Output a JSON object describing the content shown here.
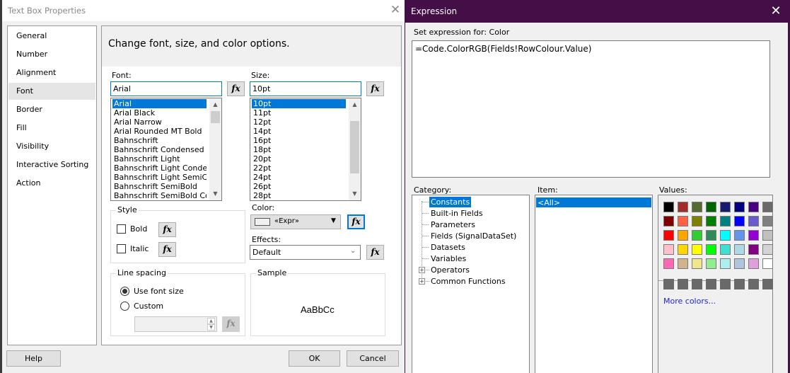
{
  "text_box_properties": {
    "title": "Text Box Properties",
    "nav_items": [
      {
        "label": "General",
        "active": false
      },
      {
        "label": "Number",
        "active": false
      },
      {
        "label": "Alignment",
        "active": false
      },
      {
        "label": "Font",
        "active": true
      },
      {
        "label": "Border",
        "active": false
      },
      {
        "label": "Fill",
        "active": false
      },
      {
        "label": "Visibility",
        "active": false
      },
      {
        "label": "Interactive Sorting",
        "active": false
      },
      {
        "label": "Action",
        "active": false
      }
    ],
    "heading": "Change font, size, and color options.",
    "font": {
      "label": "Font:",
      "value": "Arial",
      "options": [
        "Arial",
        "Arial Black",
        "Arial Narrow",
        "Arial Rounded MT Bold",
        "Bahnschrift",
        "Bahnschrift Condensed",
        "Bahnschrift Light",
        "Bahnschrift Light Condensed",
        "Bahnschrift Light SemiCondensed",
        "Bahnschrift SemiBold",
        "Bahnschrift SemiBold Condensed"
      ],
      "selected": "Arial"
    },
    "size": {
      "label": "Size:",
      "value": "10pt",
      "options": [
        "10pt",
        "11pt",
        "12pt",
        "14pt",
        "16pt",
        "18pt",
        "20pt",
        "22pt",
        "24pt",
        "26pt",
        "28pt"
      ],
      "selected": "10pt"
    },
    "style": {
      "title": "Style",
      "bold_label": "Bold",
      "bold_checked": false,
      "italic_label": "Italic",
      "italic_checked": false
    },
    "color": {
      "label": "Color:",
      "value": "«Expr»"
    },
    "effects": {
      "label": "Effects:",
      "value": "Default"
    },
    "line_spacing": {
      "title": "Line spacing",
      "option_use_font_size": "Use font size",
      "option_custom": "Custom",
      "selected": "Use font size",
      "custom_value": ""
    },
    "sample": {
      "title": "Sample",
      "text": "AaBbCc"
    },
    "fx_label": "fx",
    "buttons": {
      "help": "Help",
      "ok": "OK",
      "cancel": "Cancel"
    }
  },
  "expression_dialog": {
    "title": "Expression",
    "set_expression_label": "Set expression for: Color",
    "expression": "=Code.ColorRGB(Fields!RowColour.Value)",
    "category": {
      "label": "Category:",
      "items": [
        {
          "label": "Constants",
          "selected": true,
          "expandable": false
        },
        {
          "label": "Built-in Fields",
          "selected": false,
          "expandable": false
        },
        {
          "label": "Parameters",
          "selected": false,
          "expandable": false
        },
        {
          "label": "Fields (SignalDataSet)",
          "selected": false,
          "expandable": false
        },
        {
          "label": "Datasets",
          "selected": false,
          "expandable": false
        },
        {
          "label": "Variables",
          "selected": false,
          "expandable": false
        },
        {
          "label": "Operators",
          "selected": false,
          "expandable": true
        },
        {
          "label": "Common Functions",
          "selected": false,
          "expandable": true
        }
      ]
    },
    "item": {
      "label": "Item:",
      "items": [
        "<All>"
      ],
      "selected": "<All>"
    },
    "values": {
      "label": "Values:",
      "swatches": [
        [
          "#000000",
          "#a52a2a",
          "#556b2f",
          "#006400",
          "#191970",
          "#000080",
          "#4b0082",
          "#696969"
        ],
        [
          "#800000",
          "#ff6347",
          "#808000",
          "#008000",
          "#008080",
          "#0000ff",
          "#6a5acd",
          "#808080"
        ],
        [
          "#ff0000",
          "#ffa500",
          "#32cd32",
          "#2e8b57",
          "#00ffff",
          "#6495ed",
          "#9400d3",
          "#c0c0c0"
        ],
        [
          "#ffc0cb",
          "#ffd700",
          "#ffff00",
          "#00ff00",
          "#40e0d0",
          "#add8e6",
          "#800080",
          "#d3d3d3"
        ],
        [
          "#ff69b4",
          "#d2b48c",
          "#f0e68c",
          "#90ee90",
          "#afeeee",
          "#b0c4de",
          "#dda0dd",
          "#ffffff"
        ]
      ],
      "custom_swatches": [
        "#696969",
        "#696969",
        "#696969",
        "#696969",
        "#696969",
        "#696969",
        "#696969",
        "#696969"
      ],
      "more_colors_label": "More colors..."
    }
  }
}
